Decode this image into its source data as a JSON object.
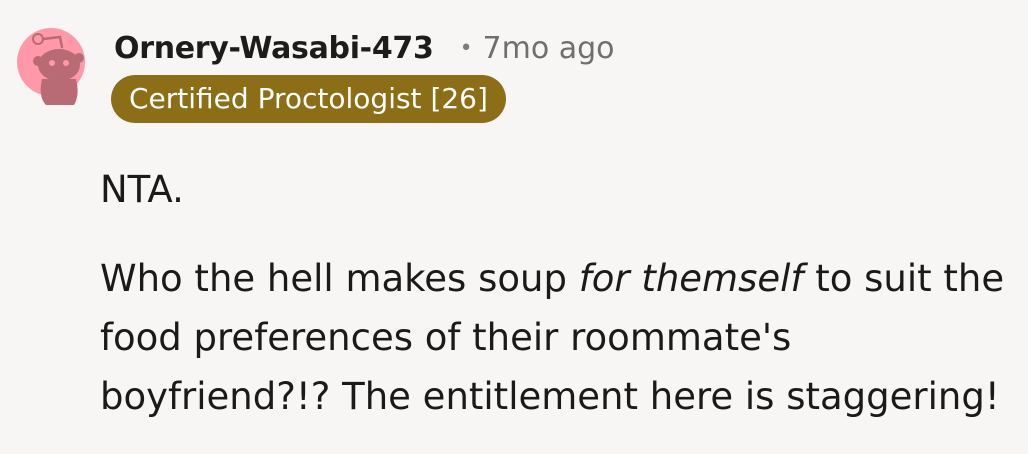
{
  "comment": {
    "author": "Ornery-Wasabi-473",
    "separator": "•",
    "age": "7mo ago",
    "flair": "Certified Proctologist [26]",
    "body": {
      "verdict": "NTA.",
      "line_prefix": "Who the hell makes soup ",
      "line_emphasis": "for themself",
      "line_suffix": " to suit the food preferences of their roommate's boyfriend?!? The entitlement here is staggering!"
    }
  },
  "colors": {
    "background": "#f8f6f4",
    "flair_background": "#8b6e15",
    "avatar_background": "#ff99aa",
    "avatar_figure": "#b86b74"
  },
  "icons": {
    "avatar": "snoo-avatar-icon"
  }
}
